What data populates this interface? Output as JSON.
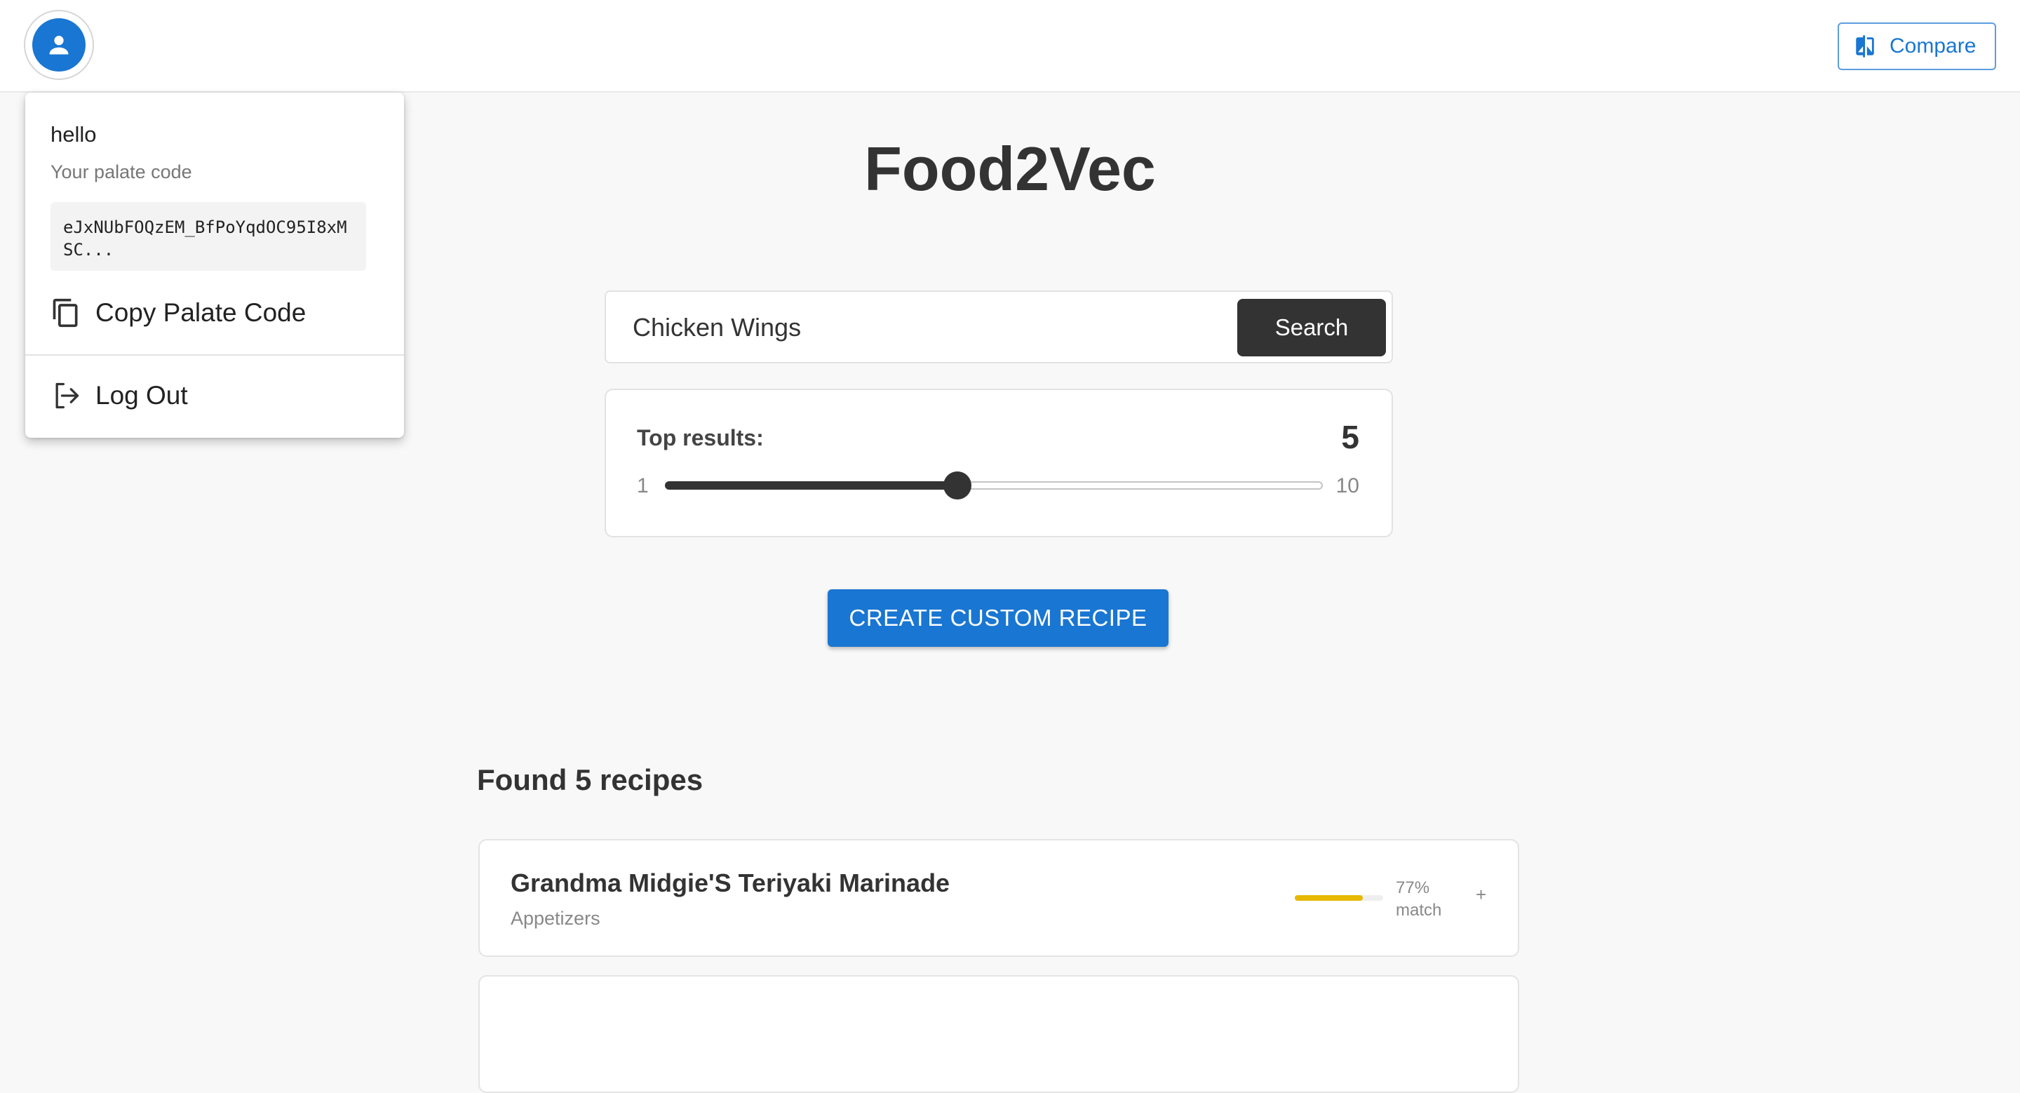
{
  "header": {
    "avatar_icon": "person-icon",
    "compare_label": "Compare",
    "compare_icon": "compare-icon"
  },
  "app": {
    "title": "Food2Vec"
  },
  "search": {
    "value": "Chicken Wings",
    "button_label": "Search"
  },
  "slider": {
    "label": "Top results:",
    "value": 5,
    "min": 1,
    "max": 10
  },
  "create_button_label": "CREATE CUSTOM RECIPE",
  "results": {
    "heading": "Found 5 recipes",
    "items": [
      {
        "name": "Grandma Midgie'S Teriyaki Marinade",
        "category": "Appetizers",
        "match_percent": 77,
        "match_label": "77%",
        "match_suffix": "match",
        "match_color": "#e6b800",
        "expand": "+"
      }
    ]
  },
  "menu": {
    "user": "hello",
    "subtitle": "Your palate code",
    "palate_code": "eJxNUbFOQzEM_BfPoYqdOC95I8xMSC...",
    "copy_label": "Copy Palate Code",
    "copy_icon": "copy-icon",
    "logout_label": "Log Out",
    "logout_icon": "logout-icon"
  },
  "colors": {
    "accent": "#1976d2",
    "dark_button": "#333333",
    "background": "#f8f8f8"
  }
}
